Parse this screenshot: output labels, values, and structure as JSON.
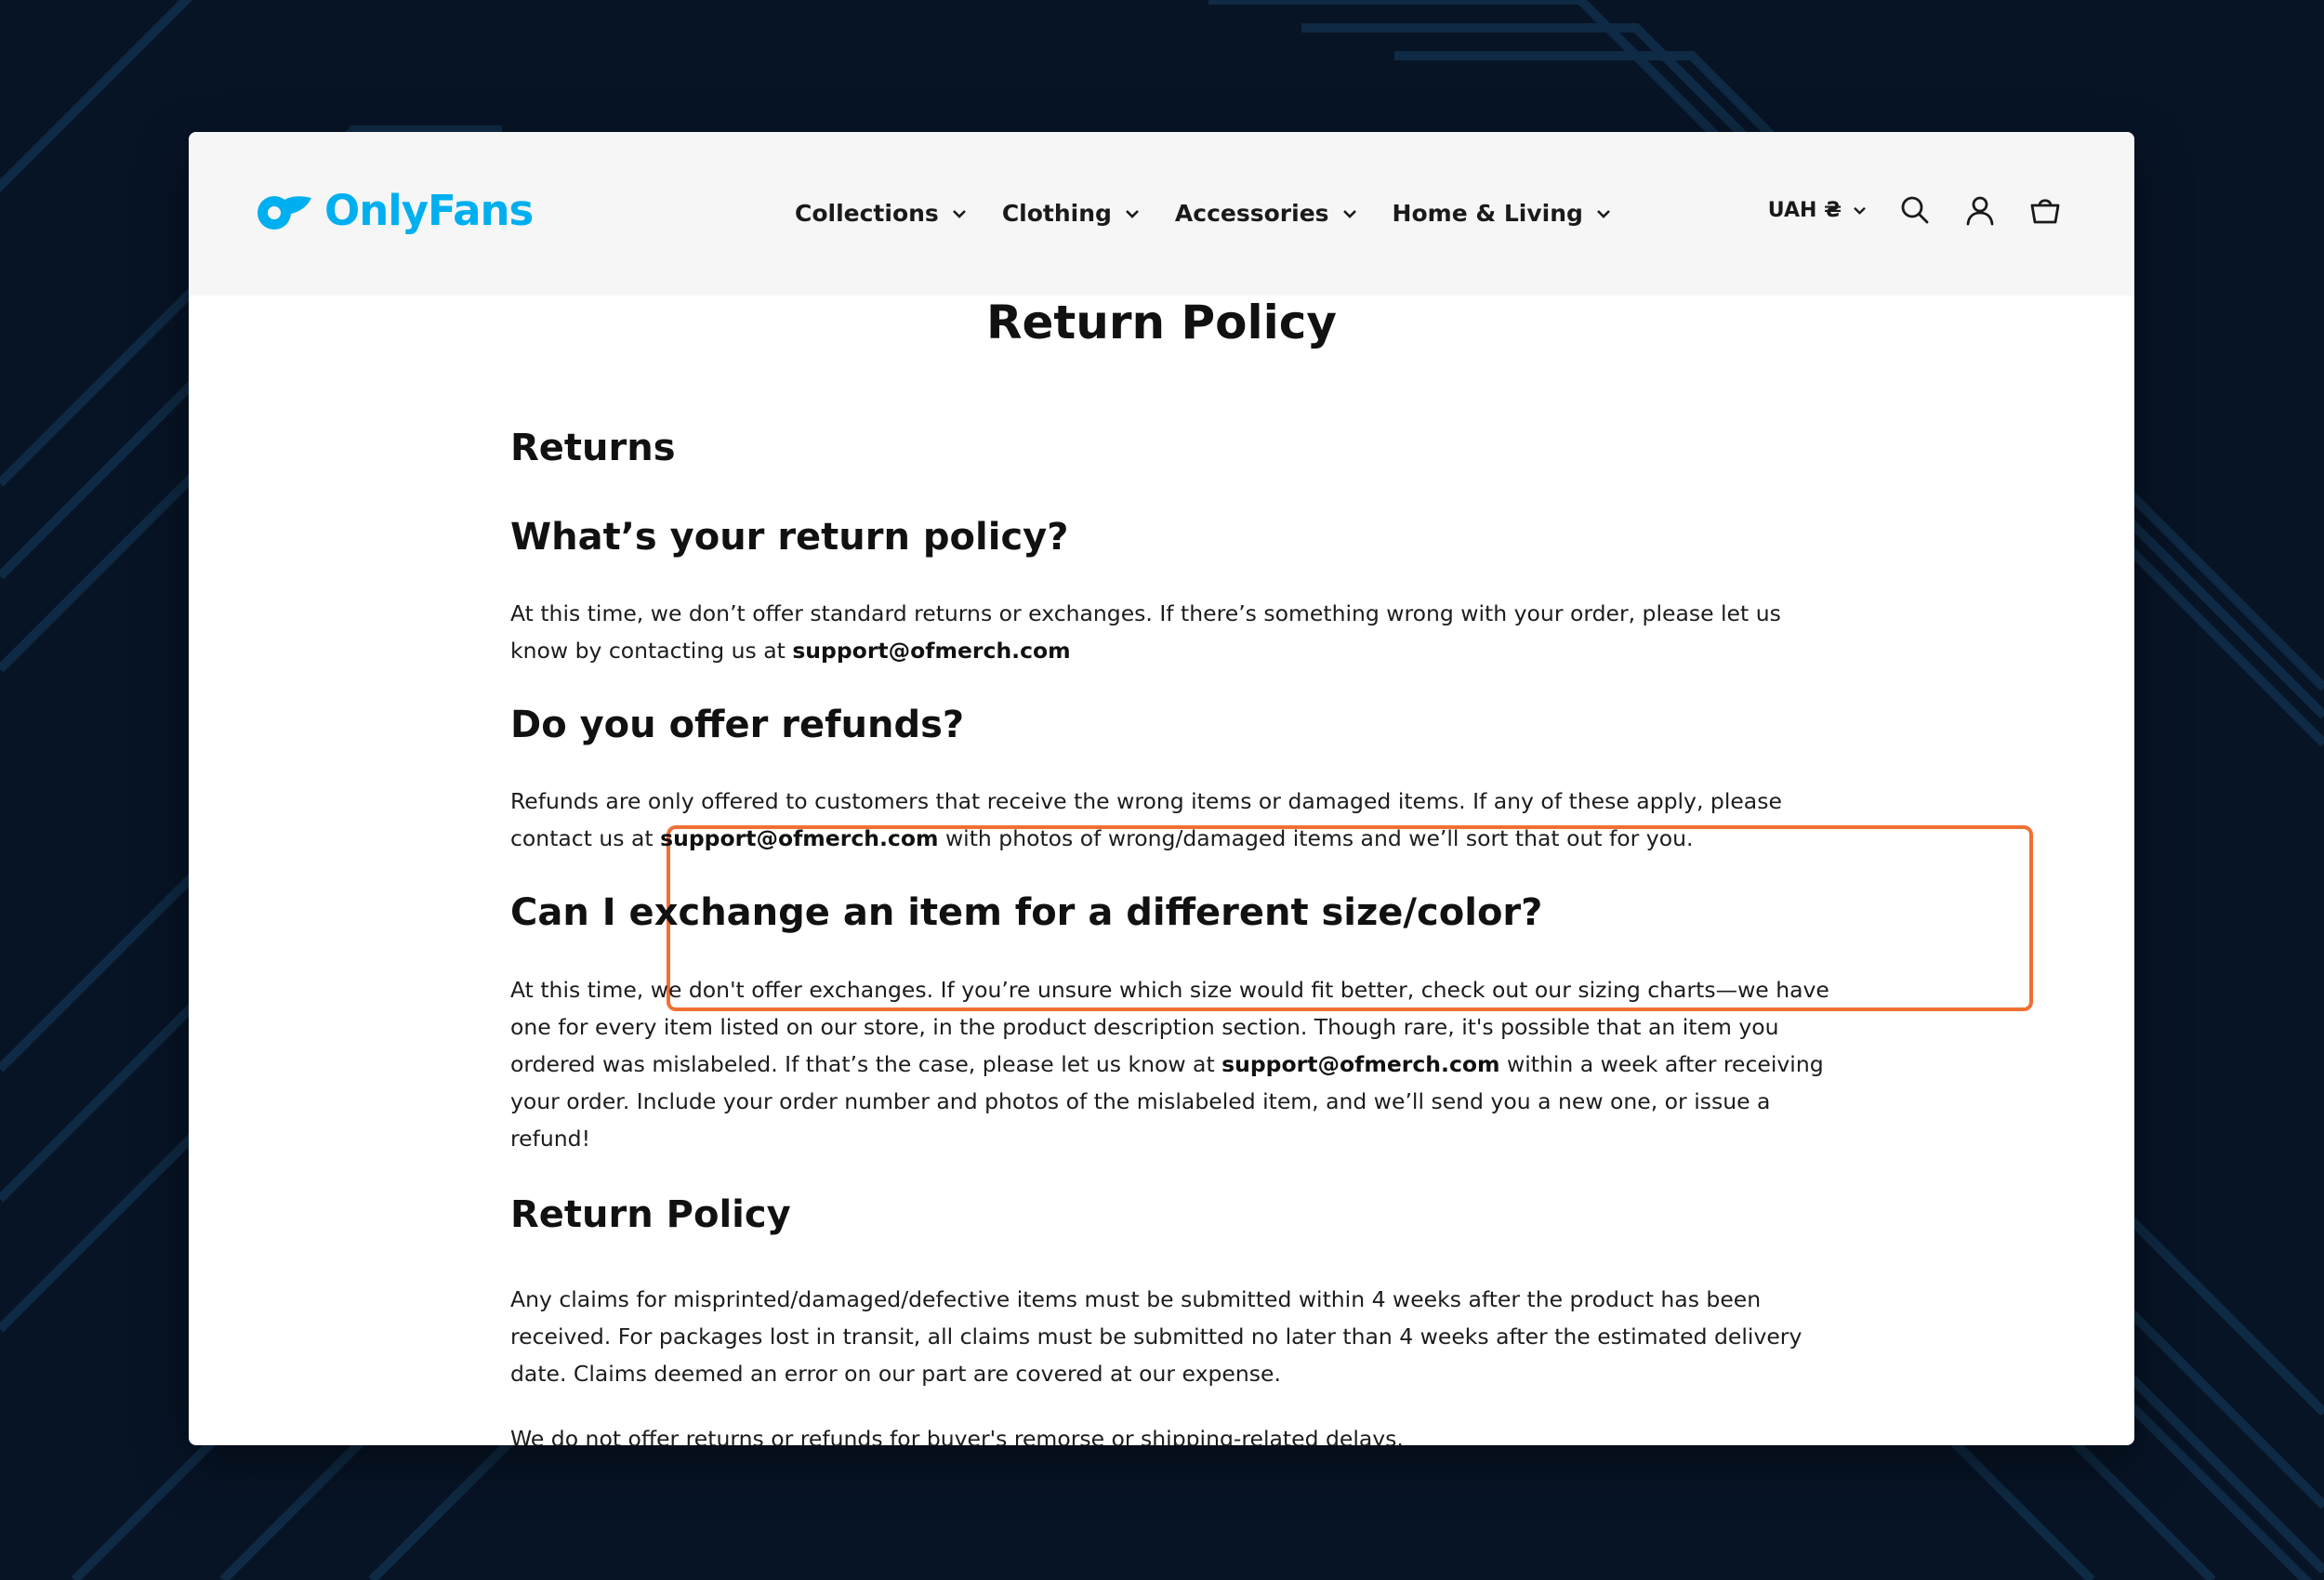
{
  "brand": {
    "name": "OnlyFans",
    "color": "#00aff0"
  },
  "nav": {
    "items": [
      {
        "label": "Collections"
      },
      {
        "label": "Clothing"
      },
      {
        "label": "Accessories"
      },
      {
        "label": "Home & Living"
      }
    ]
  },
  "header_utils": {
    "currency": "UAH ₴",
    "icons": [
      "search-icon",
      "account-icon",
      "cart-icon"
    ]
  },
  "page": {
    "title": "Return Policy",
    "sections": [
      {
        "heading": "Returns"
      },
      {
        "heading": "What’s your return policy?",
        "text_before": "At this time, we don’t offer standard returns or exchanges. If there’s something wrong with your order, please let us know by contacting us at ",
        "email": "support@ofmerch.com",
        "text_after": ""
      },
      {
        "heading": "Do you offer refunds?",
        "text_before": "Refunds are only offered to customers that receive the wrong items or damaged items. If any of these apply, please contact us at ",
        "email": "support@ofmerch.com",
        "text_after": " with photos of wrong/damaged items and we’ll sort that out for you.",
        "highlighted": true,
        "highlight_color": "#f07033"
      },
      {
        "heading": "Can I exchange an item for a different size/color?",
        "text_before": "At this time, we don't offer exchanges. If you’re unsure which size would fit better, check out our sizing charts—we have one for every item listed on our store, in the product description section. Though rare, it's possible that an item you ordered was mislabeled. If that’s the case, please let us know at ",
        "email": "support@ofmerch.com",
        "text_after": " within a week after receiving your order. Include your order number and photos of the mislabeled item, and we’ll send you a new one, or issue a refund!"
      },
      {
        "heading": "Return Policy",
        "text": "Any claims for misprinted/damaged/defective items must be submitted within 4 weeks after the product has been received. For packages lost in transit, all claims must be submitted no later than 4 weeks after the estimated delivery date. Claims deemed an error on our part are covered at our expense."
      }
    ],
    "cutoff_text": "We do not offer returns or refunds for buyer's remorse or shipping-related delays."
  }
}
